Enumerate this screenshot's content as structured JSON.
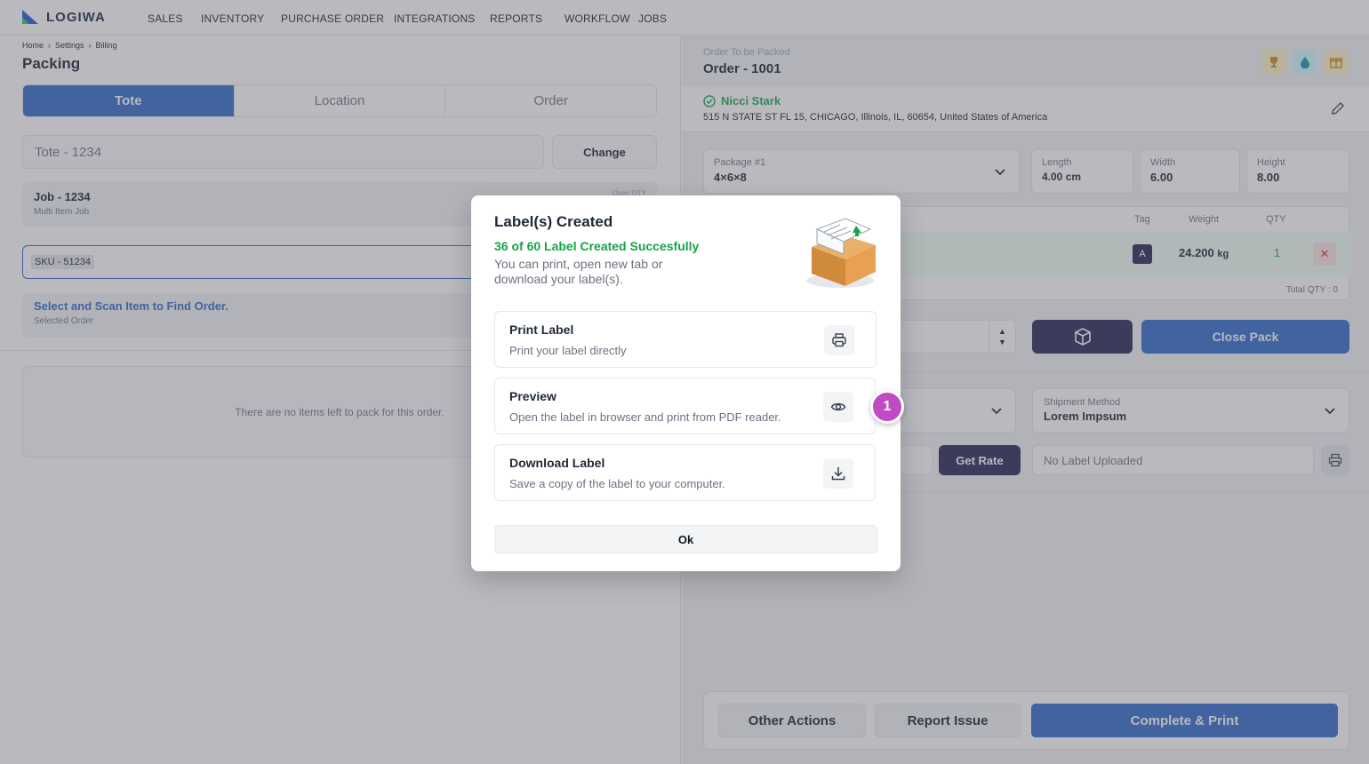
{
  "app": {
    "logo_text": "LOGIWA"
  },
  "nav": [
    {
      "label": "SALES"
    },
    {
      "label": "INVENTORY"
    },
    {
      "label": "PURCHASE ORDER"
    },
    {
      "label": "INTEGRATIONS"
    },
    {
      "label": "REPORTS"
    },
    {
      "label": "WORKFLOW"
    },
    {
      "label": "JOBS"
    }
  ],
  "breadcrumb": [
    "Home",
    "Settings",
    "Billing"
  ],
  "page_title": "Packing",
  "tabs": [
    {
      "label": "Tote",
      "active": true
    },
    {
      "label": "Location",
      "active": false
    },
    {
      "label": "Order",
      "active": false
    }
  ],
  "tote": {
    "value": "Tote - 1234",
    "change_label": "Change"
  },
  "job": {
    "title": "Job - 1234",
    "subtitle": "Multi Item Job",
    "qty_label": "Open QTY"
  },
  "sku": {
    "value": "SKU - 51234"
  },
  "scan": {
    "title": "Select and Scan Item to Find Order.",
    "subtitle": "Selected Order"
  },
  "empty_message": "There are no items left to pack for this order.",
  "order": {
    "label": "Order To be Packed",
    "number": "Order - 1001"
  },
  "customer": {
    "name": "Nicci Stark",
    "address": "515 N STATE ST FL 15, CHICAGO, Illinois, IL, 60654, United States of America"
  },
  "package": {
    "label": "Package #1",
    "value": "4×6×8",
    "length_label": "Length",
    "length_value": "4.00 cm",
    "width_label": "Width",
    "width_value": "6.00",
    "height_label": "Height",
    "height_value": "8.00"
  },
  "items_table": {
    "headers": {
      "tag": "Tag",
      "weight": "Weight",
      "qty": "QTY"
    },
    "row": {
      "tag": "A",
      "weight": "24.200",
      "weight_unit": "kg",
      "qty": "1"
    },
    "total_qty": "Total QTY : 0"
  },
  "close_pack_label": "Close Pack",
  "shipment": {
    "label": "Shipment Method",
    "value": "Lorem Impsum"
  },
  "get_rate_label": "Get Rate",
  "label_placeholder": "No Label Uploaded",
  "bottom_actions": {
    "other": "Other Actions",
    "report": "Report Issue",
    "complete": "Complete & Print"
  },
  "modal": {
    "title": "Label(s) Created",
    "success": "36 of 60 Label Created Succesfully",
    "description": "You can print, open new tab or download your label(s).",
    "options": [
      {
        "title": "Print Label",
        "subtitle": "Print your label directly",
        "icon": "printer-icon"
      },
      {
        "title": "Preview",
        "subtitle": "Open the label in browser and print from PDF reader.",
        "icon": "eye-icon"
      },
      {
        "title": "Download Label",
        "subtitle": "Save a copy of the label to your computer.",
        "icon": "download-icon"
      }
    ],
    "ok_label": "Ok"
  },
  "step_marker": "1",
  "colors": {
    "primary": "#2563c9",
    "dark": "#1e1b4b",
    "success": "#16a34a",
    "marker": "#c04bc4"
  }
}
